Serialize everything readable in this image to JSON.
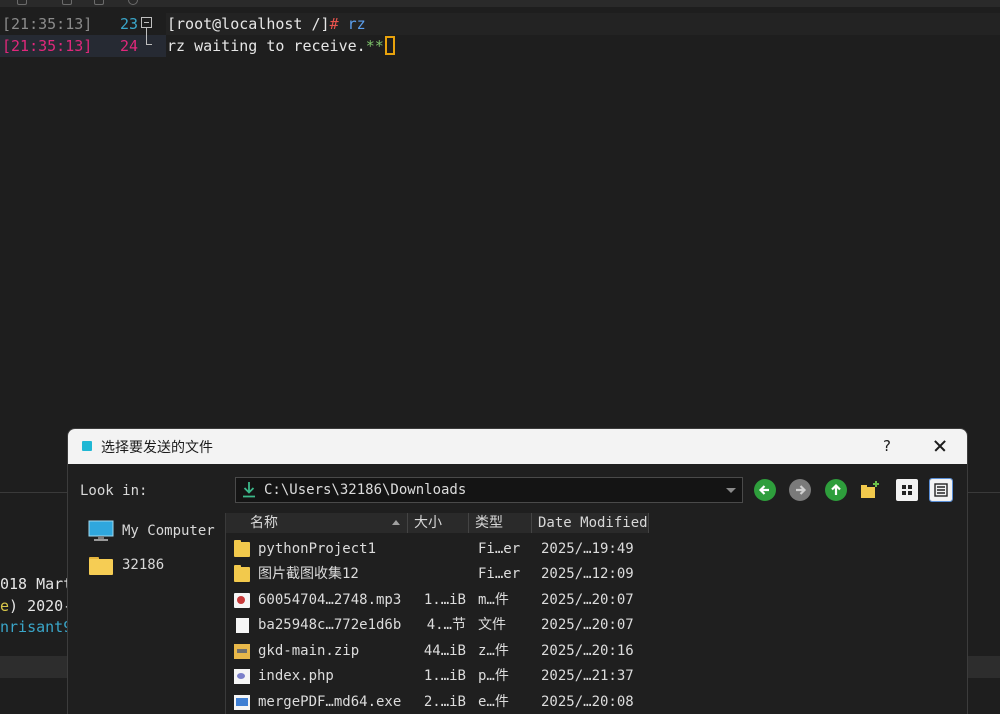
{
  "terminal": {
    "lines": [
      {
        "timestamp": "[21:35:13]",
        "line_no": "23",
        "prompt": "[root@localhost /]",
        "hash": "#",
        "command": " rz"
      },
      {
        "timestamp": "[21:35:13]",
        "line_no": "24",
        "text": "rz waiting to receive.",
        "stars": "**"
      }
    ],
    "background_lines": [
      {
        "prefix": "018 Mart"
      },
      {
        "prefix": ") 2020-",
        "paren": "e"
      },
      {
        "prefix": "nrisant9"
      }
    ]
  },
  "dialog": {
    "title": "选择要发送的文件",
    "help_label": "?",
    "look_in_label": "Look in:",
    "path": "C:\\Users\\32186\\Downloads",
    "sidebar": [
      {
        "label": "My Computer",
        "icon": "computer-icon"
      },
      {
        "label": "32186",
        "icon": "folder-icon"
      }
    ],
    "columns": {
      "name": "名称",
      "size": "大小",
      "type": "类型",
      "date": "Date Modified"
    },
    "files": [
      {
        "name": "pythonProject1",
        "size": "",
        "type": "Fi…er",
        "date": "2025/…19:49",
        "icon": "folder-icon"
      },
      {
        "name": "图片截图收集12",
        "size": "",
        "type": "Fi…er",
        "date": "2025/…12:09",
        "icon": "folder-icon"
      },
      {
        "name": "60054704…2748.mp3",
        "size": "1.…iB",
        "type": "m…件",
        "date": "2025/…20:07",
        "icon": "media-file-icon"
      },
      {
        "name": "ba25948c…772e1d6b",
        "size": "4.…节",
        "type": "文件",
        "date": "2025/…20:07",
        "icon": "document-icon"
      },
      {
        "name": "gkd-main.zip",
        "size": "44…iB",
        "type": "z…件",
        "date": "2025/…20:16",
        "icon": "zip-file-icon"
      },
      {
        "name": "index.php",
        "size": "1.…iB",
        "type": "p…件",
        "date": "2025/…21:37",
        "icon": "php-file-icon"
      },
      {
        "name": "mergePDF…md64.exe",
        "size": "2.…iB",
        "type": "e…件",
        "date": "2025/…20:08",
        "icon": "exe-file-icon"
      }
    ]
  }
}
